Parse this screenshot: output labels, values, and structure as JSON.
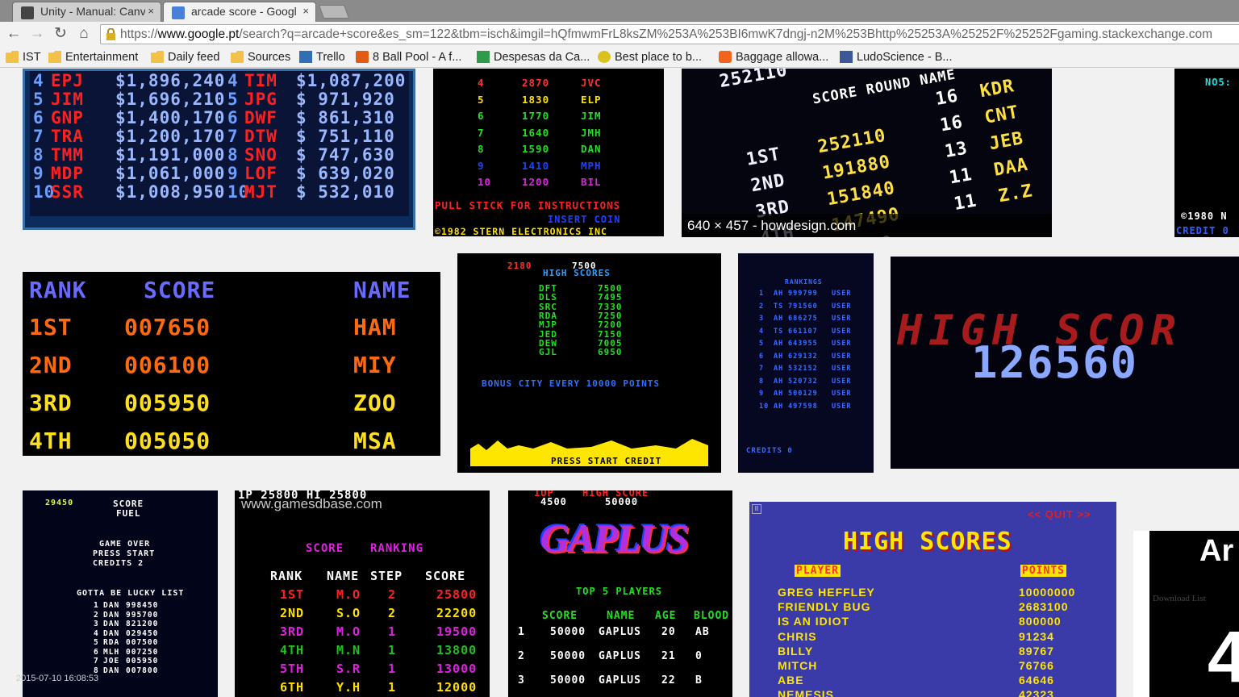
{
  "tabs": [
    {
      "title": "Unity - Manual: Canv",
      "close": "×"
    },
    {
      "title": "arcade score - Googl",
      "close": "×"
    }
  ],
  "url": {
    "scheme": "https://",
    "host": "www.google.pt",
    "path": "/search?q=arcade+score&es_sm=122&tbm=isch&imgil=hQfmwmFrL8ksZM%253A%253BI6mwK7dngj-n2M%253Bhttp%25253A%25252F%25252Fgaming.stackexchange.com"
  },
  "bookmarks": [
    {
      "label": "IST",
      "icon": "folder-icon"
    },
    {
      "label": "Entertainment",
      "icon": "folder-icon"
    },
    {
      "label": "Daily feed",
      "icon": "folder-icon"
    },
    {
      "label": "Sources",
      "icon": "folder-icon"
    },
    {
      "label": "Trello",
      "icon": "trello-icon"
    },
    {
      "label": "8 Ball Pool - A f...",
      "icon": "play-icon"
    },
    {
      "label": "Despesas da Ca...",
      "icon": "sheets-icon"
    },
    {
      "label": "Best place to b...",
      "icon": "smiley-icon"
    },
    {
      "label": "Baggage allowa...",
      "icon": "orange-icon"
    },
    {
      "label": "LudoScience - B...",
      "icon": "facebook-icon"
    }
  ],
  "results": {
    "caption": "640 × 457 - howdesign.com",
    "timestamp": "2015-07-10 16:08:53",
    "img1_rows": [
      [
        "4",
        "EPJ",
        "$1,896,240",
        "4",
        "TIM",
        "$1,087,200"
      ],
      [
        "5",
        "JIM",
        "$1,696,210",
        "5",
        "JPG",
        "$ 971,920"
      ],
      [
        "6",
        "GNP",
        "$1,400,170",
        "6",
        "DWF",
        "$ 861,310"
      ],
      [
        "7",
        "TRA",
        "$1,200,170",
        "7",
        "DTW",
        "$ 751,110"
      ],
      [
        "8",
        "TMM",
        "$1,191,000",
        "8",
        "SNO",
        "$ 747,630"
      ],
      [
        "9",
        "MDP",
        "$1,061,000",
        "9",
        "LOF",
        "$ 639,020"
      ],
      [
        "10",
        "SSR",
        "$1,008,950",
        "10",
        "MJT",
        "$ 532,010"
      ]
    ],
    "img2_rows": [
      [
        "4",
        "2870",
        "JVC"
      ],
      [
        "5",
        "1830",
        "ELP"
      ],
      [
        "6",
        "1770",
        "JIM"
      ],
      [
        "7",
        "1640",
        "JMH"
      ],
      [
        "8",
        "1590",
        "DAN"
      ],
      [
        "9",
        "1410",
        "MPH"
      ],
      [
        "10",
        "1200",
        "BIL"
      ]
    ],
    "img2_footer": [
      "PULL STICK FOR INSTRUCTIONS",
      "INSERT COIN",
      "©1982 STERN ELECTRONICS INC"
    ],
    "img3_top": "252110",
    "img3_header": "SCORE ROUND NAME",
    "img3_rows": [
      [
        "",
        "",
        "16",
        "KDR"
      ],
      [
        "1ST",
        "252110",
        "16",
        "CNT"
      ],
      [
        "2ND",
        "191880",
        "13",
        "JEB"
      ],
      [
        "3RD",
        "151840",
        "11",
        "DAA"
      ],
      [
        "4TH",
        "147490",
        "11",
        "Z.Z"
      ],
      [
        "",
        "11700",
        "",
        ""
      ]
    ],
    "img4_text": [
      "NO5:",
      "©1980 N",
      "CREDIT 0"
    ],
    "img5_header": [
      "RANK",
      "SCORE",
      "NAME"
    ],
    "img5_rows": [
      [
        "1ST",
        "007650",
        "HAM"
      ],
      [
        "2ND",
        "006100",
        "MIY"
      ],
      [
        "3RD",
        "005950",
        "ZOO"
      ],
      [
        "4TH",
        "005050",
        "MSA"
      ]
    ],
    "img6_top": [
      "2180",
      "7500"
    ],
    "img6_title": "HIGH SCORES",
    "img6_rows": [
      [
        "DFT",
        "7500"
      ],
      [
        "DLS",
        "7495"
      ],
      [
        "SRC",
        "7330"
      ],
      [
        "RDA",
        "7250"
      ],
      [
        "MJP",
        "7200"
      ],
      [
        "JED",
        "7150"
      ],
      [
        "DEW",
        "7005"
      ],
      [
        "GJL",
        "6950"
      ]
    ],
    "img6_bonus": "BONUS CITY EVERY 10000 POINTS",
    "img6_footer": "PRESS START   CREDIT",
    "img7_title": "RANKINGS",
    "img7_rows": [
      [
        "1",
        "AH",
        "999799",
        "USER"
      ],
      [
        "2",
        "TS",
        "791560",
        "USER"
      ],
      [
        "3",
        "AH",
        "686275",
        "USER"
      ],
      [
        "4",
        "TS",
        "661107",
        "USER"
      ],
      [
        "5",
        "AH",
        "643955",
        "USER"
      ],
      [
        "6",
        "AH",
        "629132",
        "USER"
      ],
      [
        "7",
        "AH",
        "532152",
        "USER"
      ],
      [
        "8",
        "AH",
        "520732",
        "USER"
      ],
      [
        "9",
        "AH",
        "500129",
        "USER"
      ],
      [
        "10",
        "AH",
        "497598",
        "USER"
      ]
    ],
    "img7_footer": "CREDITS 0",
    "img8_title": "HIGH SCOR",
    "img8_score": "126560",
    "img9_top": "29450",
    "img9_lines": [
      "SCORE",
      "FUEL",
      "GAME OVER",
      "PRESS START",
      "CREDITS  2",
      "GOTTA BE LUCKY LIST"
    ],
    "img9_rows": [
      [
        "1",
        "DAN",
        "998450"
      ],
      [
        "2",
        "DAN",
        "995700"
      ],
      [
        "3",
        "DAN",
        "821200"
      ],
      [
        "4",
        "DAN",
        "029450"
      ],
      [
        "5",
        "RDA",
        "007500"
      ],
      [
        "6",
        "MLH",
        "007250"
      ],
      [
        "7",
        "JOE",
        "005950"
      ],
      [
        "8",
        "DAN",
        "007800"
      ]
    ],
    "img10_top": "1P  25800   HI  25800",
    "img10_watermark": "www.gamesdbase.com",
    "img10_title": [
      "SCORE",
      "RANKING"
    ],
    "img10_header": [
      "RANK",
      "NAME",
      "STEP",
      "SCORE"
    ],
    "img10_rows": [
      [
        "1ST",
        "M.O",
        "2",
        "25800"
      ],
      [
        "2ND",
        "S.O",
        "2",
        "22200"
      ],
      [
        "3RD",
        "M.O",
        "1",
        "19500"
      ],
      [
        "4TH",
        "M.N",
        "1",
        "13800"
      ],
      [
        "5TH",
        "S.R",
        "1",
        "13000"
      ],
      [
        "6TH",
        "Y.H",
        "1",
        "12000"
      ]
    ],
    "img11_top": [
      "1UP",
      "HIGH SCORE"
    ],
    "img11_topvals": [
      "4500",
      "50000"
    ],
    "img11_logo": "GAPLUS",
    "img11_sub": "TOP 5 PLAYERS",
    "img11_header": [
      "SCORE",
      "NAME",
      "AGE",
      "BLOOD"
    ],
    "img11_rows": [
      [
        "1",
        "50000",
        "GAPLUS",
        "20",
        "AB"
      ],
      [
        "2",
        "50000",
        "GAPLUS",
        "21",
        "0"
      ],
      [
        "3",
        "50000",
        "GAPLUS",
        "22",
        "B"
      ]
    ],
    "img12_quit": "<< QUIT >>",
    "img12_title": "HIGH SCORES",
    "img12_header": [
      "PLAYER",
      "POINTS"
    ],
    "img12_rows": [
      [
        "GREG HEFFLEY",
        "10000000"
      ],
      [
        "FRIENDLY BUG",
        "2683100"
      ],
      [
        "IS AN IDIOT",
        "800000"
      ],
      [
        "CHRIS",
        "91234"
      ],
      [
        "BILLY",
        "89767"
      ],
      [
        "MITCH",
        "76766"
      ],
      [
        "ABE",
        "64646"
      ],
      [
        "NEMESIS",
        "42323"
      ]
    ],
    "img13_text": [
      "Ar",
      "Download List",
      "4"
    ]
  },
  "colors": {
    "tabstrip": "#8b8b8b",
    "toolbar": "#f2f2f2",
    "page": "#f1f1f1",
    "blue": "#4a6cff",
    "red": "#ff2020",
    "yellow": "#ffe600"
  }
}
